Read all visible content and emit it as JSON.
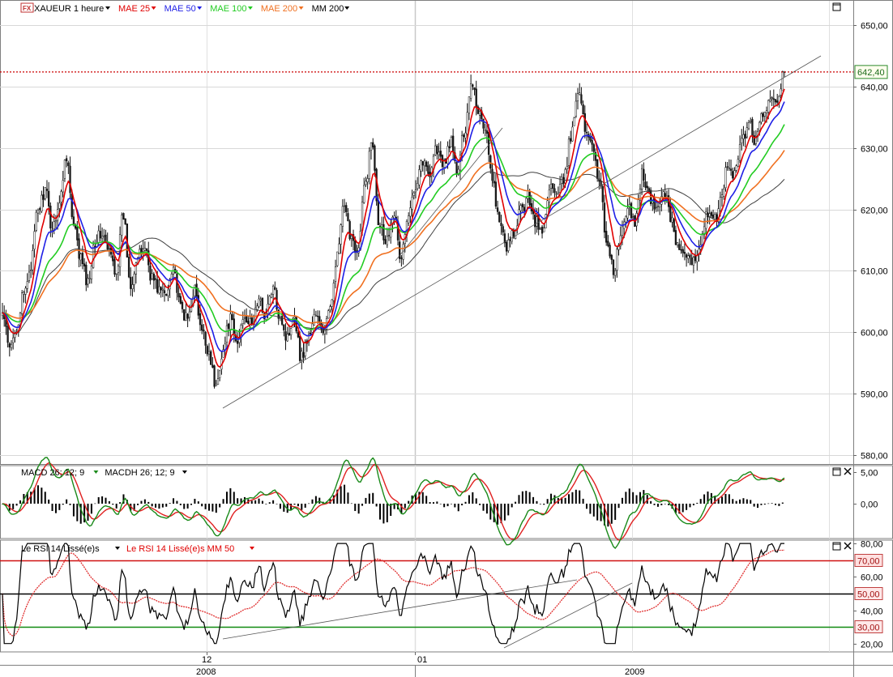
{
  "colors": {
    "background": "#ffffff",
    "grid": "#d8d8d8",
    "candle_up": "#ffffff",
    "candle_down": "#1a1a1a",
    "mae25": "#e00000",
    "mae50": "#1f1fe6",
    "mae100": "#22cc22",
    "mae200": "#f07020",
    "mm200": "#404040",
    "macd": "#1a8a1a",
    "macd_signal": "#e02020",
    "price_line": "#cc0000",
    "rsi": "#000000",
    "rsi_ma": "#e03030",
    "level_70": "#d01010",
    "level_50": "#000000",
    "level_30": "#108a10"
  },
  "main_panel": {
    "symbol": "XAUEUR",
    "symbol_badge": "FX",
    "timeframe": "1 heure",
    "legend": [
      {
        "label": "MAE 25",
        "color": "#e00000"
      },
      {
        "label": "MAE 50",
        "color": "#1f1fe6"
      },
      {
        "label": "MAE 100",
        "color": "#22cc22"
      },
      {
        "label": "MAE 200",
        "color": "#f07020"
      },
      {
        "label": "MM 200",
        "color": "#000000"
      }
    ],
    "last_price": "642,40"
  },
  "macd_panel": {
    "legend": [
      {
        "label": "MACD 26; 12; 9",
        "color": "#1a8a1a"
      },
      {
        "label": "MACDH 26; 12; 9",
        "color": "#000000"
      }
    ]
  },
  "rsi_panel": {
    "legend": [
      {
        "label": "Le RSI 14 Lissé(e)s",
        "color": "#000000"
      },
      {
        "label": "Le RSI 14 Lissé(e)s MM 50",
        "color": "#e00000"
      }
    ],
    "levels": [
      "70,00",
      "50,00",
      "30,00"
    ]
  },
  "time_axis": {
    "months": [
      "12",
      "01"
    ],
    "years": [
      "2008",
      "2009"
    ]
  },
  "chart_data": [
    {
      "type": "candlestick",
      "y_ticks": [
        "650,00",
        "640,00",
        "630,00",
        "620,00",
        "610,00",
        "600,00",
        "590,00",
        "580,00"
      ],
      "ylim": [
        578.5,
        654
      ],
      "series_names": [
        "MAE 25",
        "MAE 50",
        "MAE 100",
        "MAE 200",
        "MM 200"
      ],
      "close_path": [
        603,
        597,
        601,
        606,
        611,
        620,
        623,
        617,
        621,
        629,
        617,
        612,
        608,
        615,
        616,
        613,
        610,
        619,
        608,
        612,
        614,
        609,
        607,
        606,
        611,
        604,
        602,
        607,
        600,
        597,
        591,
        597,
        602,
        598,
        603,
        601,
        605,
        603,
        607,
        603,
        599,
        603,
        596,
        599,
        603,
        600,
        603,
        612,
        620,
        616,
        613,
        624,
        631,
        618,
        615,
        620,
        612,
        618,
        624,
        628,
        626,
        630,
        627,
        631,
        626,
        633,
        641,
        636,
        633,
        624,
        617,
        614,
        616,
        620,
        622,
        618,
        616,
        624,
        622,
        625,
        632,
        640,
        633,
        631,
        624,
        615,
        610,
        616,
        620,
        618,
        626,
        622,
        620,
        623,
        619,
        614,
        612,
        611,
        614,
        619,
        618,
        621,
        627,
        626,
        631,
        634,
        631,
        636,
        637,
        638,
        643
      ],
      "last_close": 642.4
    },
    {
      "type": "line",
      "name": "MACD 26; 12; 9",
      "y_ticks": [
        "5,00",
        "0,00"
      ],
      "ylim": [
        -5.5,
        6
      ]
    },
    {
      "type": "line",
      "name": "Le RSI 14 Lissé(e)s",
      "y_ticks": [
        "80,00",
        "60,00",
        "40,00",
        "20,00"
      ],
      "levels": [
        70,
        50,
        30
      ],
      "ylim": [
        15,
        82
      ]
    }
  ]
}
